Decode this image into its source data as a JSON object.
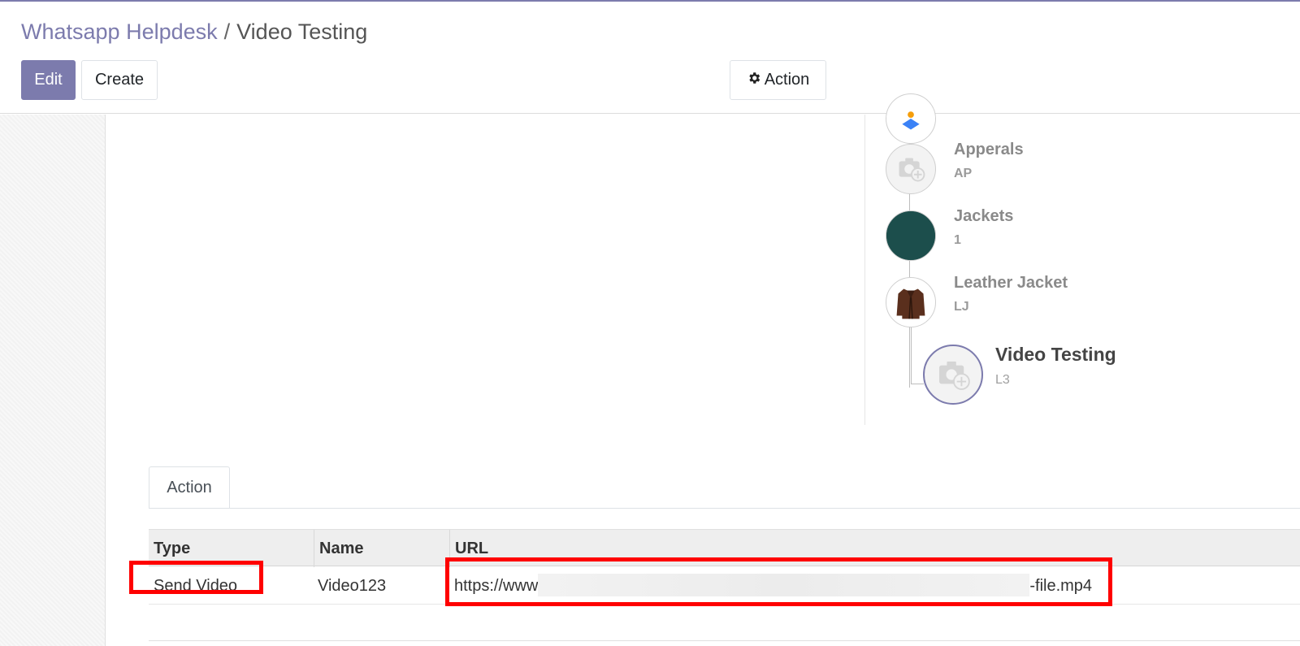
{
  "breadcrumb": {
    "parent": "Whatsapp Helpdesk",
    "separator": "/",
    "current": "Video Testing"
  },
  "buttons": {
    "edit": "Edit",
    "create": "Create",
    "action": "Action"
  },
  "hierarchy": [
    {
      "name": "Apperals",
      "code": "AP",
      "avatar": "camera-placeholder"
    },
    {
      "name": "Jackets",
      "code": "1",
      "avatar": "fabric-swatch"
    },
    {
      "name": "Leather Jacket",
      "code": "LJ",
      "avatar": "jacket-photo"
    },
    {
      "name": "Video Testing",
      "code": "L3",
      "avatar": "camera-placeholder",
      "current": true
    }
  ],
  "tabs": [
    {
      "label": "Action",
      "active": true
    }
  ],
  "table": {
    "columns": [
      "Type",
      "Name",
      "URL"
    ],
    "rows": [
      {
        "type": "Send Video",
        "name": "Video123",
        "url_start": "https://www",
        "url_end": "-file.mp4"
      }
    ]
  },
  "colors": {
    "brand": "#7c7bad",
    "highlight": "#ff0000",
    "jackets_swatch": "#1c4e4c"
  }
}
